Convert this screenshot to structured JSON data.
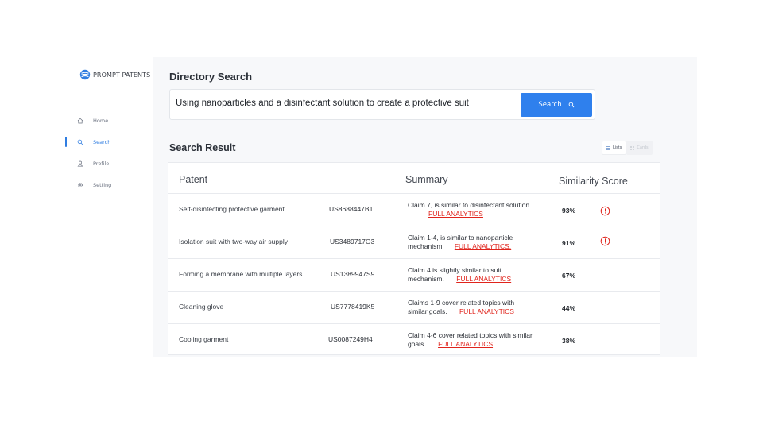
{
  "brand": {
    "name": "PROMPT PATENTS"
  },
  "nav": [
    {
      "label": "Home",
      "icon": "home-icon",
      "active": false
    },
    {
      "label": "Search",
      "icon": "search-icon",
      "active": true
    },
    {
      "label": "Profile",
      "icon": "user-icon",
      "active": false
    },
    {
      "label": "Setting",
      "icon": "gear-icon",
      "active": false
    }
  ],
  "page": {
    "title": "Directory Search"
  },
  "search": {
    "value": "Using nanoparticles and a disinfectant solution to create a protective suit",
    "button_label": "Search"
  },
  "results": {
    "title": "Search Result",
    "view_lists": "Lists",
    "view_cards": "Cards",
    "columns": {
      "patent": "Patent",
      "summary": "Summary",
      "score": "Similarity Score"
    },
    "rows": [
      {
        "title": "Self-disinfecting protective garment",
        "number": "US8688447B1",
        "summary": "Claim  7, is similar to disinfectant solution.",
        "link": "FULL ANALYTICS",
        "score": "93%",
        "alert": true
      },
      {
        "title": "Isolation suit with two-way air supply",
        "number": "US3489717O3",
        "summary": "Claim 1-4, is similar to nanoparticle mechanism",
        "link": "FULL ANALYTICS.",
        "score": "91%",
        "alert": true
      },
      {
        "title": "Forming a membrane with multiple layers",
        "number": "US1389947S9",
        "summary": "Claim 4 is slightly similar to suit mechanism.",
        "link": "FULL ANALYTICS",
        "score": "67%",
        "alert": false
      },
      {
        "title": "Cleaning glove",
        "number": "US7778419K5",
        "summary": "Claims 1-9 cover related topics with similar goals.",
        "link": "FULL ANALYTICS",
        "score": "44%",
        "alert": false
      },
      {
        "title": "Cooling garment",
        "number": "US0087249H4",
        "summary": "Claim 4-6 cover related topics with similar goals.",
        "link": "FULL ANALYTICS",
        "score": "38%",
        "alert": false
      }
    ]
  },
  "colors": {
    "accent": "#2f80ed",
    "link": "#e0241c",
    "alert": "#e0241c"
  }
}
